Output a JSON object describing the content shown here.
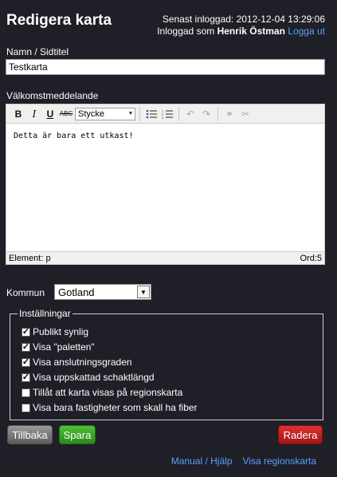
{
  "header": {
    "title": "Redigera karta",
    "last_login": "Senast inloggad: 2012-12-04 13:29:06",
    "logged_in_prefix": "Inloggad som",
    "user_name": "Henrik Östman",
    "logout_label": "Logga ut"
  },
  "form": {
    "name_label": "Namn / Sidtitel",
    "name_value": "Testkarta",
    "welcome_label": "Välkomstmeddelande",
    "format_select": "Stycke",
    "editor_text": "Detta är bara ett utkast!",
    "status_element": "Element: p",
    "status_words": "Ord:5",
    "kommun_label": "Kommun",
    "kommun_value": "Gotland"
  },
  "settings": {
    "legend": "Inställningar",
    "options": [
      {
        "label": "Publikt synlig",
        "checked": true
      },
      {
        "label": "Visa \"paletten\"",
        "checked": true
      },
      {
        "label": "Visa anslutningsgraden",
        "checked": true
      },
      {
        "label": "Visa uppskattad schaktlängd",
        "checked": true
      },
      {
        "label": "Tillåt att karta visas på regionskarta",
        "checked": false
      },
      {
        "label": "Visa bara fastigheter som skall ha fiber",
        "checked": false
      }
    ]
  },
  "buttons": {
    "back": "Tillbaka",
    "save": "Spara",
    "delete": "Radera"
  },
  "footer_links": {
    "manual": "Manual / Hjälp",
    "region_map": "Visa regionskarta"
  }
}
